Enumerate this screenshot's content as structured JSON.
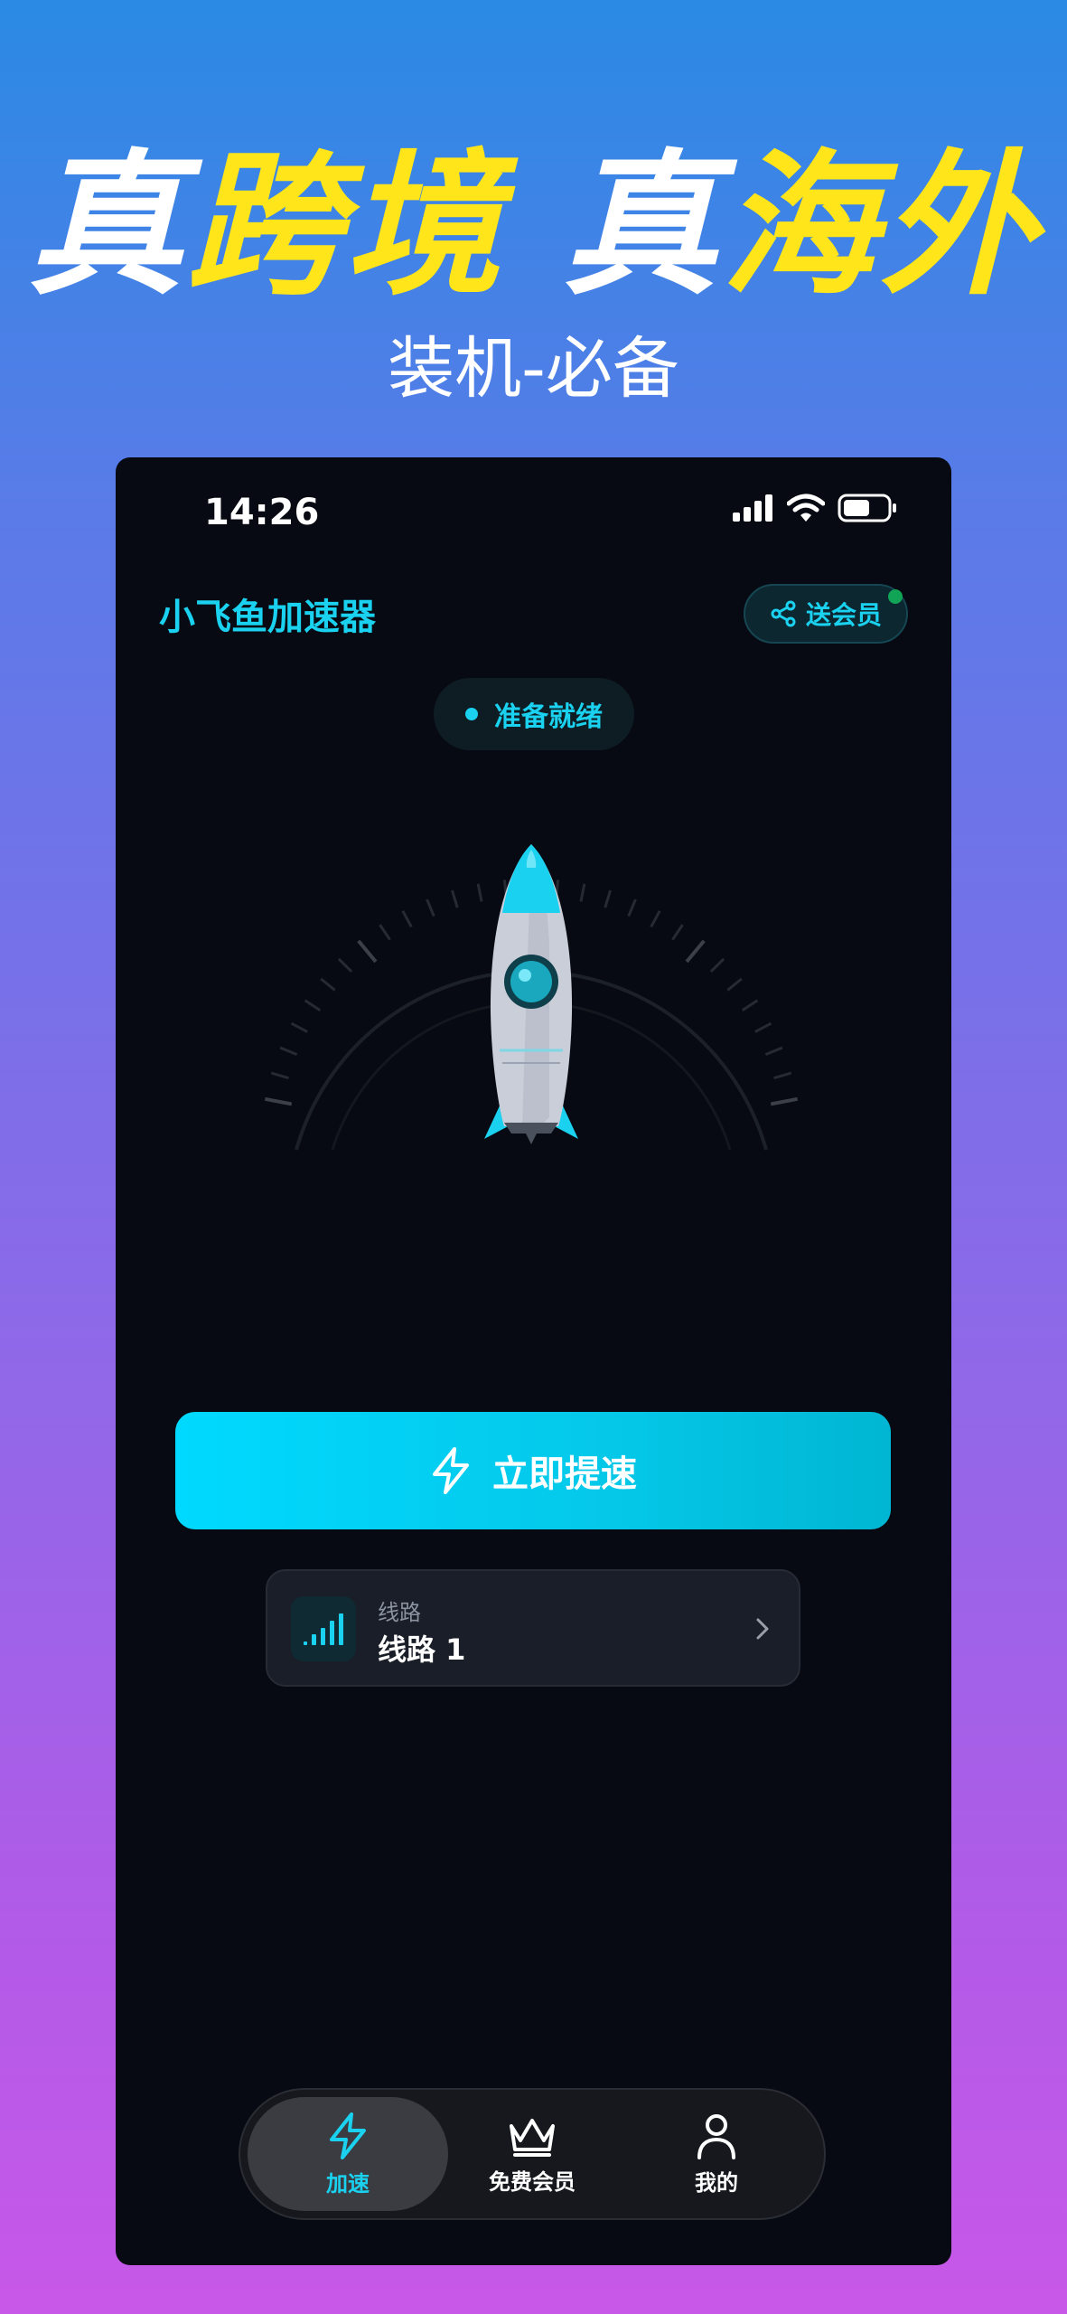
{
  "promo": {
    "headline_part1": "真",
    "headline_part2": "跨境",
    "headline_part3": " 真",
    "headline_part4": "海外",
    "subline": "装机-必备"
  },
  "status_bar": {
    "time": "14:26",
    "battery_level": 0.6
  },
  "header": {
    "app_title": "小飞鱼加速器",
    "share_label": "送会员"
  },
  "status_pill": {
    "label": "准备就绪"
  },
  "main": {
    "speed_button_label": "立即提速"
  },
  "line_selector": {
    "caption": "线路",
    "value": "线路 1"
  },
  "tabs": [
    {
      "label": "加速",
      "icon": "lightning-icon",
      "active": true
    },
    {
      "label": "免费会员",
      "icon": "crown-icon",
      "active": false
    },
    {
      "label": "我的",
      "icon": "user-icon",
      "active": false
    }
  ],
  "colors": {
    "accent": "#1ad2f0",
    "headline_yellow": "#ffe51a",
    "phone_bg": "#070a12",
    "gradient_top": "#2a8ae4",
    "gradient_bottom": "#c858e8"
  }
}
